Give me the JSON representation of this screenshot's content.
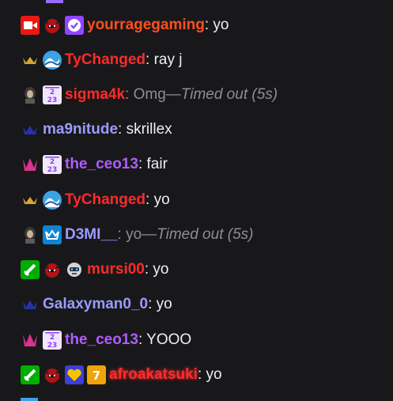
{
  "messages": [
    {
      "user": "yourragegaming",
      "user_color": "#ff4f1f",
      "text": ": yo",
      "timed_out": "",
      "badges": [
        "video-badge",
        "devil-avatar-badge",
        "verified-badge"
      ]
    },
    {
      "user": "TyChanged",
      "user_color": "#ff2b2b",
      "text": ": ray j",
      "timed_out": "",
      "badges": [
        "gold-crown-badge",
        "wave-badge"
      ]
    },
    {
      "user": "sigma4k",
      "user_color": "#ff2b2b",
      "text": ": Omg—",
      "timed_out": "Timed out (5s)",
      "badges": [
        "portrait-badge",
        "sub-2023-badge"
      ]
    },
    {
      "user": "ma9nitude",
      "user_color": "#9b9bff",
      "text": ": skrillex",
      "timed_out": "",
      "badges": [
        "blue-crown-badge"
      ]
    },
    {
      "user": "the_ceo13",
      "user_color": "#b05cff",
      "text": ": fair",
      "timed_out": "",
      "badges": [
        "pink-crown-badge",
        "sub-2023-badge"
      ]
    },
    {
      "user": "TyChanged",
      "user_color": "#ff2b2b",
      "text": ": yo",
      "timed_out": "",
      "badges": [
        "gold-crown-badge",
        "wave-badge"
      ]
    },
    {
      "user": "D3MI__",
      "user_color": "#9b9bff",
      "text": ": yo—",
      "timed_out": "Timed out (5s)",
      "badges": [
        "portrait-badge",
        "prime-crown-badge"
      ]
    },
    {
      "user": "mursi00",
      "user_color": "#ff2b2b",
      "text": ": yo",
      "timed_out": "",
      "badges": [
        "moderator-sword-badge",
        "devil-avatar-badge",
        "robot-badge"
      ]
    },
    {
      "user": "Galaxyman0_0",
      "user_color": "#9b9bff",
      "text": ": yo",
      "timed_out": "",
      "badges": [
        "blue-crown-badge"
      ]
    },
    {
      "user": "the_ceo13",
      "user_color": "#b05cff",
      "text": ": YOOO",
      "timed_out": "",
      "badges": [
        "pink-crown-badge",
        "sub-2023-badge"
      ]
    },
    {
      "user": "afroakatsuki",
      "user_color": "#ff2b2b",
      "text": ": yo",
      "timed_out": "",
      "badges": [
        "moderator-sword-badge",
        "devil-avatar-badge",
        "heart-badge",
        "gold-gift-badge"
      ]
    }
  ]
}
